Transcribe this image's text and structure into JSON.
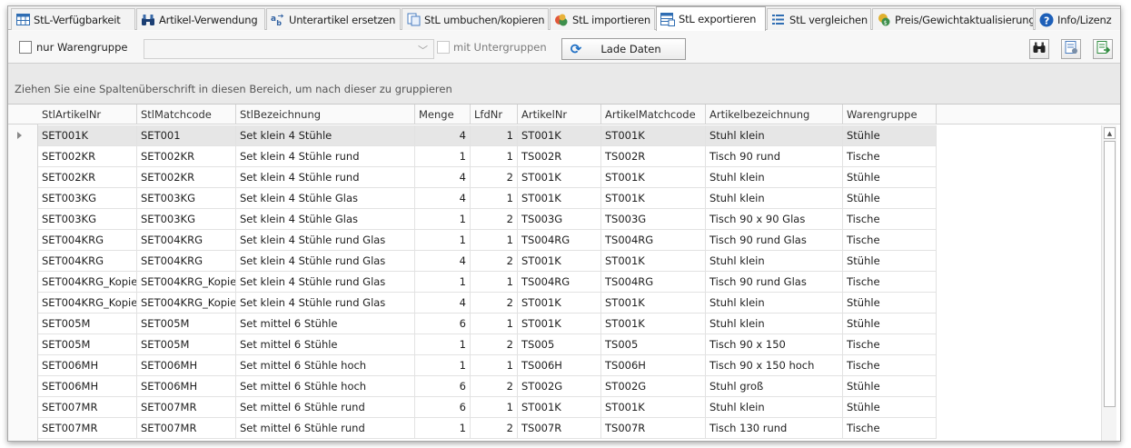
{
  "tabs": [
    {
      "label": "StL-Verfügbarkeit",
      "icon": "grid-icon",
      "active": false
    },
    {
      "label": "Artikel-Verwendung",
      "icon": "binoculars-icon",
      "active": false
    },
    {
      "label": "Unterartikel ersetzen",
      "icon": "replace-icon",
      "active": false
    },
    {
      "label": "StL umbuchen/kopieren",
      "icon": "copy-icon",
      "active": false
    },
    {
      "label": "StL importieren",
      "icon": "import-icon",
      "active": false
    },
    {
      "label": "StL exportieren",
      "icon": "export-icon",
      "active": true
    },
    {
      "label": "StL vergleichen",
      "icon": "list-compare-icon",
      "active": false
    },
    {
      "label": "Preis/Gewichtaktualisierung",
      "icon": "price-icon",
      "active": false
    },
    {
      "label": "Info/Lizenz",
      "icon": "info-icon",
      "active": false
    }
  ],
  "toolbar": {
    "warengruppe_label": "nur Warengruppe",
    "warengruppe_value": "",
    "untergruppen_label": "mit Untergruppen",
    "load_label": "Lade Daten"
  },
  "group_panel": {
    "hint": "Ziehen Sie eine Spaltenüberschrift in diesen Bereich, um nach dieser zu gruppieren"
  },
  "grid": {
    "columns": [
      "StlArtikelNr",
      "StlMatchcode",
      "StlBezeichnung",
      "Menge",
      "LfdNr",
      "ArtikelNr",
      "ArtikelMatchcode",
      "Artikelbezeichnung",
      "Warengruppe"
    ],
    "rows": [
      [
        "SET001K",
        "SET001",
        "Set klein 4 Stühle",
        "4",
        "1",
        "ST001K",
        "ST001K",
        "Stuhl klein",
        "Stühle"
      ],
      [
        "SET002KR",
        "SET002KR",
        "Set klein 4 Stühle rund",
        "1",
        "1",
        "TS002R",
        "TS002R",
        "Tisch 90 rund",
        "Tische"
      ],
      [
        "SET002KR",
        "SET002KR",
        "Set klein 4 Stühle rund",
        "4",
        "2",
        "ST001K",
        "ST001K",
        "Stuhl klein",
        "Stühle"
      ],
      [
        "SET003KG",
        "SET003KG",
        "Set klein 4 Stühle Glas",
        "4",
        "1",
        "ST001K",
        "ST001K",
        "Stuhl klein",
        "Stühle"
      ],
      [
        "SET003KG",
        "SET003KG",
        "Set klein 4 Stühle Glas",
        "1",
        "2",
        "TS003G",
        "TS003G",
        "Tisch 90 x 90 Glas",
        "Tische"
      ],
      [
        "SET004KRG",
        "SET004KRG",
        "Set klein 4 Stühle rund Glas",
        "1",
        "1",
        "TS004RG",
        "TS004RG",
        "Tisch 90 rund Glas",
        "Tische"
      ],
      [
        "SET004KRG",
        "SET004KRG",
        "Set klein 4 Stühle rund Glas",
        "4",
        "2",
        "ST001K",
        "ST001K",
        "Stuhl klein",
        "Stühle"
      ],
      [
        "SET004KRG_Kopie",
        "SET004KRG_Kopie",
        "Set klein 4 Stühle rund Glas",
        "1",
        "1",
        "TS004RG",
        "TS004RG",
        "Tisch 90 rund Glas",
        "Tische"
      ],
      [
        "SET004KRG_Kopie",
        "SET004KRG_Kopie",
        "Set klein 4 Stühle rund Glas",
        "4",
        "2",
        "ST001K",
        "ST001K",
        "Stuhl klein",
        "Stühle"
      ],
      [
        "SET005M",
        "SET005M",
        "Set mittel 6 Stühle",
        "6",
        "1",
        "ST001K",
        "ST001K",
        "Stuhl klein",
        "Stühle"
      ],
      [
        "SET005M",
        "SET005M",
        "Set mittel 6 Stühle",
        "1",
        "2",
        "TS005",
        "TS005",
        "Tisch 90 x 150",
        "Tische"
      ],
      [
        "SET006MH",
        "SET006MH",
        "Set mittel 6 Stühle hoch",
        "1",
        "1",
        "TS006H",
        "TS006H",
        "Tisch 90 x 150 hoch",
        "Tische"
      ],
      [
        "SET006MH",
        "SET006MH",
        "Set mittel 6 Stühle hoch",
        "6",
        "2",
        "ST002G",
        "ST002G",
        "Stuhl groß",
        "Stühle"
      ],
      [
        "SET007MR",
        "SET007MR",
        "Set mittel 6 Stühle rund",
        "6",
        "1",
        "ST001K",
        "ST001K",
        "Stuhl klein",
        "Stühle"
      ],
      [
        "SET007MR",
        "SET007MR",
        "Set mittel 6 Stühle rund",
        "1",
        "2",
        "TS007R",
        "TS007R",
        "Tisch 130 rund",
        "Tische"
      ]
    ]
  }
}
